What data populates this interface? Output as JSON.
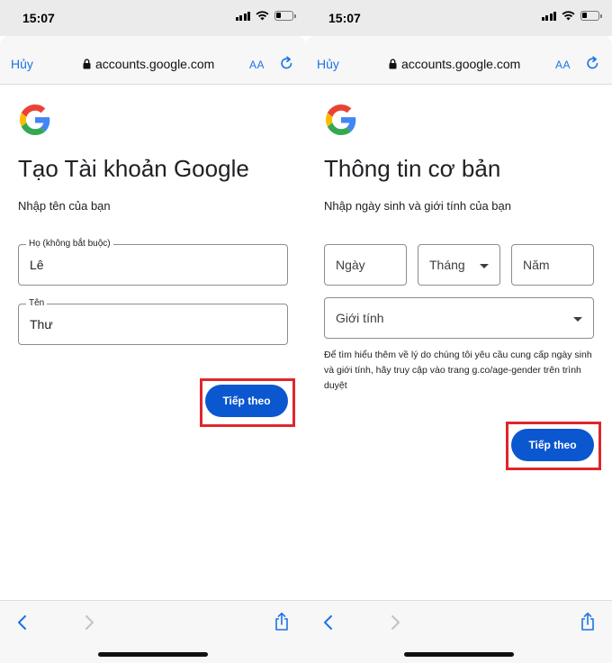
{
  "status_bar": {
    "time": "15:07"
  },
  "browser": {
    "cancel_label": "Hủy",
    "host": "accounts.google.com",
    "text_size_label": "AA"
  },
  "screen_name": {
    "heading": "Tạo Tài khoản Google",
    "subtitle": "Nhập tên của bạn",
    "last_name": {
      "label": "Họ (không bắt buộc)",
      "value": "Lê"
    },
    "first_name": {
      "label": "Tên",
      "value": "Thư"
    },
    "next_label": "Tiếp theo"
  },
  "screen_basic": {
    "heading": "Thông tin cơ bản",
    "subtitle": "Nhập ngày sinh và giới tính của bạn",
    "day_placeholder": "Ngày",
    "month_placeholder": "Tháng",
    "year_placeholder": "Năm",
    "gender_placeholder": "Giới tính",
    "note": "Để tìm hiểu thêm về lý do chúng tôi yêu cầu cung cấp ngày sinh và giới tính, hãy truy cập vào trang g.co/age-gender trên trình duyệt",
    "next_label": "Tiếp theo"
  },
  "colors": {
    "primary_button": "#0b57d0",
    "highlight_box": "#e0262b",
    "link_blue": "#1a73e8"
  },
  "icons": [
    "lock-icon",
    "reload-icon",
    "back-icon",
    "forward-icon",
    "share-icon",
    "google-logo-icon",
    "wifi-icon",
    "signal-icon",
    "battery-icon"
  ]
}
